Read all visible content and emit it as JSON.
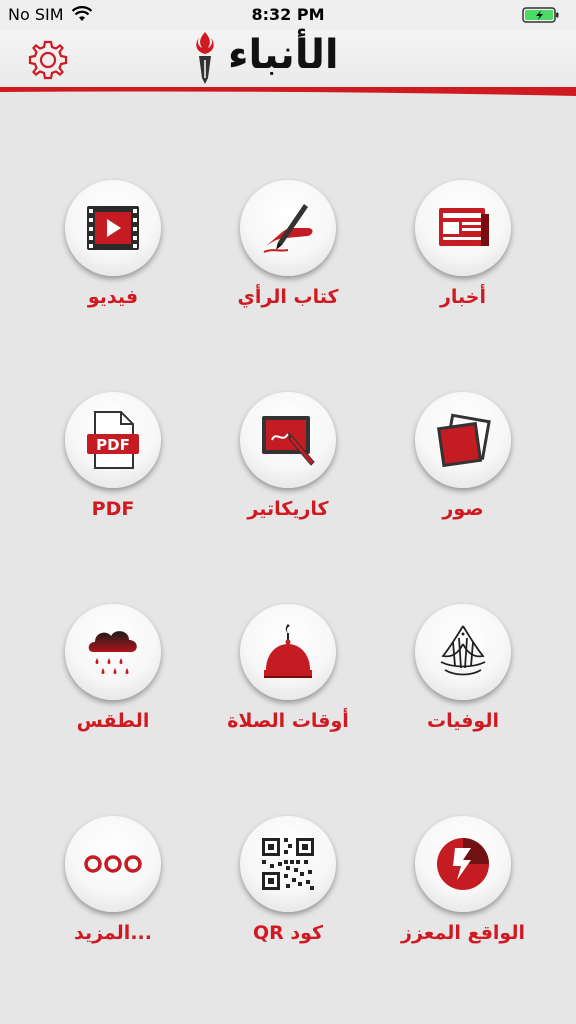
{
  "status_bar": {
    "carrier": "No SIM",
    "time": "8:32 PM"
  },
  "header": {
    "logo_text": "الأنباء"
  },
  "colors": {
    "accent_red": "#d01a22",
    "background": "#e6e6e6"
  },
  "tiles": [
    {
      "label": "أخبار",
      "icon": "newspaper-icon"
    },
    {
      "label": "كتاب الرأي",
      "icon": "pen-writing-icon"
    },
    {
      "label": "فيديو",
      "icon": "video-icon"
    },
    {
      "label": "صور",
      "icon": "photos-icon"
    },
    {
      "label": "كاريكاتير",
      "icon": "caricature-icon"
    },
    {
      "label": "PDF",
      "icon": "pdf-icon"
    },
    {
      "label": "الوفيات",
      "icon": "calligraphy-icon"
    },
    {
      "label": "أوقات الصلاة",
      "icon": "mosque-dome-icon"
    },
    {
      "label": "الطقس",
      "icon": "rain-cloud-icon"
    },
    {
      "label": "الواقع المعزز",
      "icon": "augmented-reality-icon"
    },
    {
      "label": "QR كود",
      "icon": "qr-code-icon"
    },
    {
      "label": "المزيد...",
      "icon": "more-icon"
    }
  ]
}
